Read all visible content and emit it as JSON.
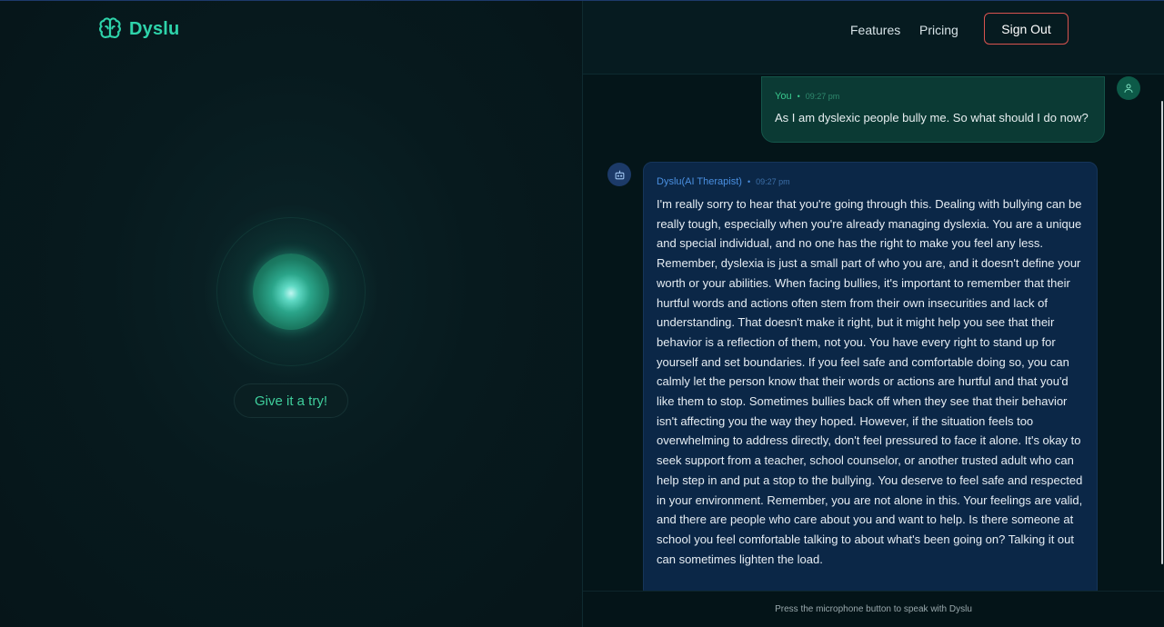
{
  "brand": {
    "name": "Dyslu",
    "icon": "brain-icon",
    "color": "#2ed3aa"
  },
  "left": {
    "try_button": "Give it a try!",
    "orb_color": "#2ba58a"
  },
  "nav": {
    "features": "Features",
    "pricing": "Pricing",
    "sign_out": "Sign Out",
    "sign_out_border": "#d9534f"
  },
  "chat": {
    "messages": [
      {
        "sender": "You",
        "time": "09:27 pm",
        "avatar_icon": "user-icon",
        "text": "As I am dyslexic people bully me. So what should I do now?"
      },
      {
        "sender": "Dyslu(AI Therapist)",
        "time": "09:27 pm",
        "avatar_icon": "robot-icon",
        "text": "I'm really sorry to hear that you're going through this. Dealing with bullying can be really tough, especially when you're already managing dyslexia. You are a unique and special individual, and no one has the right to make you feel any less. Remember, dyslexia is just a small part of who you are, and it doesn't define your worth or your abilities. When facing bullies, it's important to remember that their hurtful words and actions often stem from their own insecurities and lack of understanding. That doesn't make it right, but it might help you see that their behavior is a reflection of them, not you. You have every right to stand up for yourself and set boundaries. If you feel safe and comfortable doing so, you can calmly let the person know that their words or actions are hurtful and that you'd like them to stop. Sometimes bullies back off when they see that their behavior isn't affecting you the way they hoped. However, if the situation feels too overwhelming to address directly, don't feel pressured to face it alone. It's okay to seek support from a teacher, school counselor, or another trusted adult who can help step in and put a stop to the bullying. You deserve to feel safe and respected in your environment. Remember, you are not alone in this. Your feelings are valid, and there are people who care about you and want to help. Is there someone at school you feel comfortable talking to about what's been going on? Talking it out can sometimes lighten the load."
      }
    ]
  },
  "footer": {
    "hint": "Press the microphone button to speak with Dyslu"
  }
}
